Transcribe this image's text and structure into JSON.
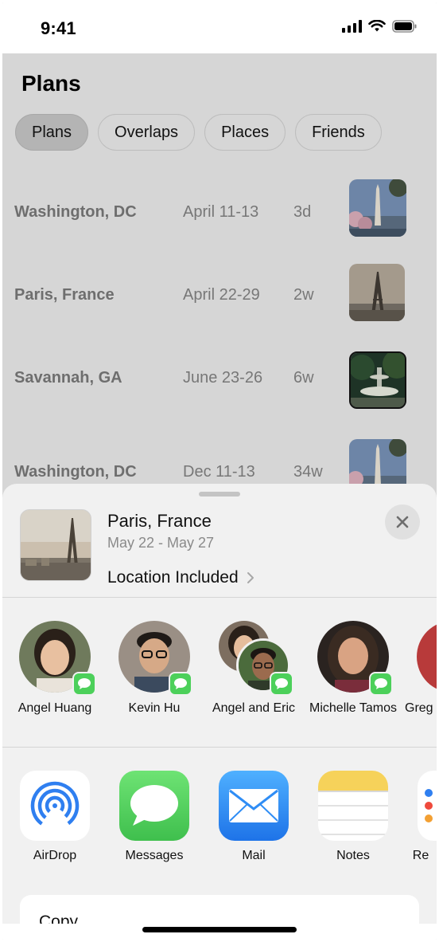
{
  "status_bar": {
    "time": "9:41"
  },
  "page": {
    "title": "Plans",
    "tabs": [
      {
        "label": "Plans",
        "active": true
      },
      {
        "label": "Overlaps",
        "active": false
      },
      {
        "label": "Places",
        "active": false
      },
      {
        "label": "Friends",
        "active": false
      }
    ],
    "plans": [
      {
        "city": "Washington, DC",
        "dates": "April 11-13",
        "until": "3d",
        "image": "washington-monument-photo"
      },
      {
        "city": "Paris, France",
        "dates": "April 22-29",
        "until": "2w",
        "image": "eiffel-tower-photo"
      },
      {
        "city": "Savannah, GA",
        "dates": "June 23-26",
        "until": "6w",
        "image": "fountain-photo"
      },
      {
        "city": "Washington, DC",
        "dates": "Dec 11-13",
        "until": "34w",
        "image": "washington-monument-photo"
      }
    ]
  },
  "share_sheet": {
    "title": "Paris, France",
    "subtitle": "May 22 - May 27",
    "location_label": "Location Included",
    "people": [
      {
        "name": "Angel Huang"
      },
      {
        "name": "Kevin Hu"
      },
      {
        "name": "Angel and Eric"
      },
      {
        "name": "Michelle Tamos"
      },
      {
        "name": "Greg"
      }
    ],
    "apps": [
      {
        "name": "AirDrop",
        "icon": "airdrop-icon"
      },
      {
        "name": "Messages",
        "icon": "messages-icon"
      },
      {
        "name": "Mail",
        "icon": "mail-icon"
      },
      {
        "name": "Notes",
        "icon": "notes-icon"
      },
      {
        "name": "Re",
        "icon": "reminders-icon"
      }
    ],
    "actions": [
      {
        "label": "Copy"
      }
    ]
  },
  "colors": {
    "messages_green": "#4cd05a",
    "mail_blue": "#2f8df5",
    "airdrop_blue": "#2f7ff0",
    "notes_yellow": "#f6d25a"
  }
}
